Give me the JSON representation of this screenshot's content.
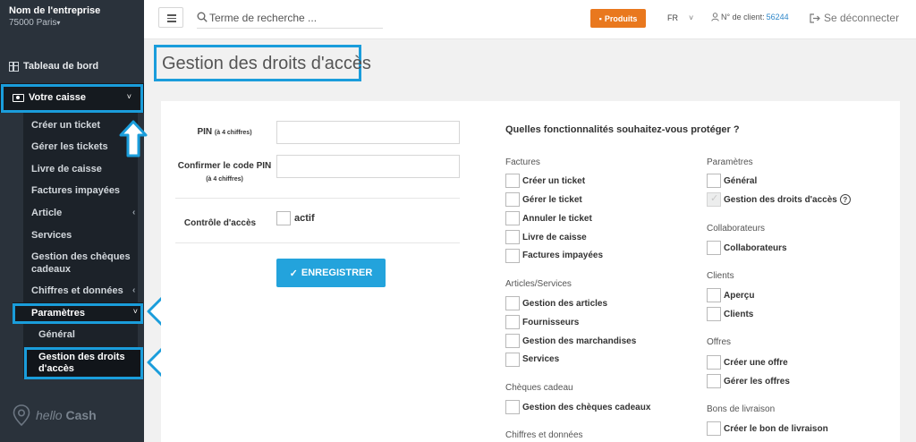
{
  "sidebar": {
    "company_name": "Nom de l'entreprise",
    "company_city": "75000 Paris",
    "dashboard": "Tableau de bord",
    "caisse": "Votre caisse",
    "caisse_items": [
      "Créer un ticket",
      "Gérer les tickets",
      "Livre de caisse",
      "Factures impayées",
      "Article",
      "Services",
      "Gestion des chèques cadeaux",
      "Chiffres et données"
    ],
    "parametres": "Paramètres",
    "param_items": [
      "Général",
      "Gestion des droits d'accès"
    ],
    "logo_text_italic": "hello",
    "logo_text": "Cash"
  },
  "topbar": {
    "search_placeholder": "Terme de recherche ...",
    "produits": "Produits",
    "lang": "FR",
    "client_label": "N° de client:",
    "client_number": "56244",
    "logout": "Se déconnecter"
  },
  "page": {
    "title": "Gestion des droits d'accès"
  },
  "form": {
    "pin_label": "PIN",
    "pin_hint": "(à 4 chiffres)",
    "confirm_label": "Confirmer le code PIN",
    "confirm_hint": "(à 4 chiffres)",
    "access_label": "Contrôle d'accès",
    "actif": "actif",
    "save": "ENREGISTRER"
  },
  "features": {
    "question": "Quelles fonctionnalités souhaitez-vous protéger ?",
    "left": [
      {
        "group": "Factures",
        "items": [
          "Créer un ticket",
          "Gérer le ticket",
          "Annuler le ticket",
          "Livre de caisse",
          "Factures impayées"
        ]
      },
      {
        "group": "Articles/Services",
        "items": [
          "Gestion des articles",
          "Fournisseurs",
          "Gestion des marchandises",
          "Services"
        ]
      },
      {
        "group": "Chèques cadeau",
        "items": [
          "Gestion des chèques cadeaux"
        ]
      },
      {
        "group": "Chiffres et données",
        "items": []
      }
    ],
    "right": [
      {
        "group": "Paramètres",
        "items": [
          "Général",
          "Gestion des droits d'accès"
        ]
      },
      {
        "group": "Collaborateurs",
        "items": [
          "Collaborateurs"
        ]
      },
      {
        "group": "Clients",
        "items": [
          "Aperçu",
          "Clients"
        ]
      },
      {
        "group": "Offres",
        "items": [
          "Créer une offre",
          "Gérer les offres"
        ]
      },
      {
        "group": "Bons de livraison",
        "items": [
          "Créer le bon de livraison"
        ]
      }
    ]
  },
  "colors": {
    "sidebar_bg": "#2a323b",
    "accent_blue": "#23a3dc",
    "highlight": "#1a9ddb",
    "orange": "#e9781e"
  }
}
